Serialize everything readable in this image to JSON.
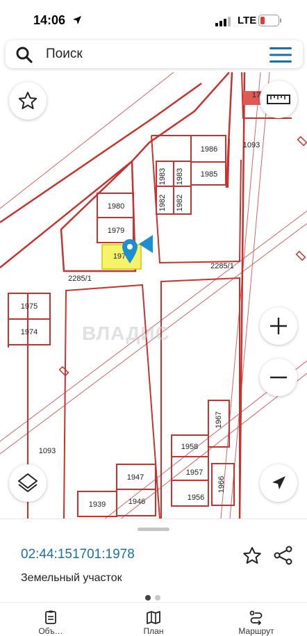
{
  "status_bar": {
    "time": "14:06",
    "network": "LTE"
  },
  "search": {
    "placeholder": "Поиск"
  },
  "map": {
    "parcel_labels": [
      "1986",
      "1983",
      "1985",
      "1983",
      "1982",
      "1982",
      "1980",
      "1979",
      "1978",
      "2285/1",
      "2285/1",
      "1975",
      "1974",
      "1093",
      "1093",
      "1967",
      "1958",
      "1957",
      "1966",
      "1956",
      "1947",
      "1939",
      "1946",
      "17"
    ],
    "selected_parcel_label": "197",
    "watermark": "ВЛАДИС",
    "colors": {
      "boundary": "#c8322e",
      "selection_fill": "#f5f36a",
      "pin": "#1d8fd0",
      "accent": "#1a6fa8"
    }
  },
  "panel": {
    "cadastral_number": "02:44:151701:1978",
    "object_type": "Земельный участок",
    "pages": 2,
    "active_page": 1
  },
  "tabs": [
    {
      "label": "Объ…",
      "icon": "document-icon"
    },
    {
      "label": "План",
      "icon": "map-icon"
    },
    {
      "label": "Маршрут",
      "icon": "route-icon"
    }
  ]
}
